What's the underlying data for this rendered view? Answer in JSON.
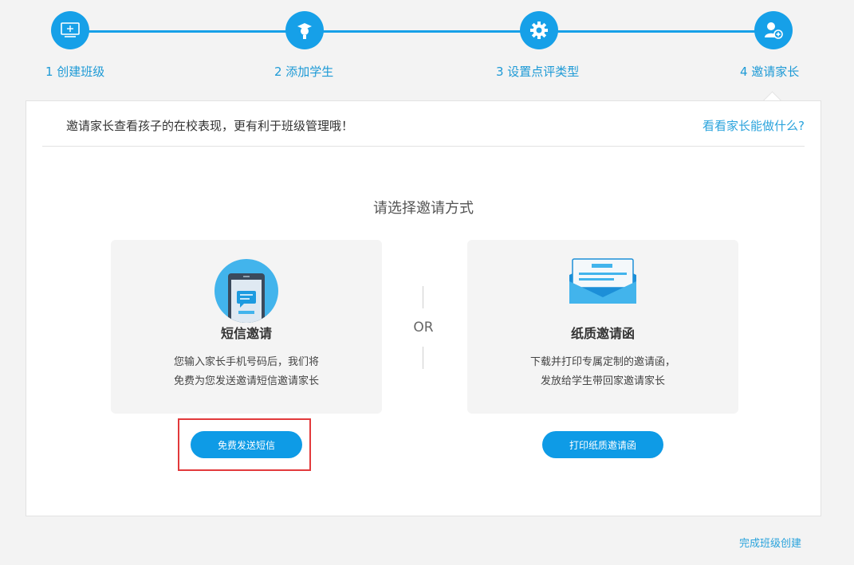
{
  "steps": [
    {
      "label": "1 创建班级",
      "icon": "monitor-plus-icon"
    },
    {
      "label": "2 添加学生",
      "icon": "student-icon"
    },
    {
      "label": "3 设置点评类型",
      "icon": "gear-icon"
    },
    {
      "label": "4 邀请家长",
      "icon": "add-parent-icon"
    }
  ],
  "header": {
    "intro": "邀请家长查看孩子的在校表现，更有利于班级管理哦！",
    "help_link": "看看家长能做什么?"
  },
  "choose_title": "请选择邀请方式",
  "or_text": "OR",
  "sms_card": {
    "title": "短信邀请",
    "desc_line1": "您输入家长手机号码后，我们将",
    "desc_line2": "免费为您发送邀请短信邀请家长",
    "button": "免费发送短信",
    "icon": "phone-message-icon"
  },
  "paper_card": {
    "title": "纸质邀请函",
    "desc_line1": "下载并打印专属定制的邀请函，",
    "desc_line2": "发放给学生带回家邀请家长",
    "button": "打印纸质邀请函",
    "icon": "envelope-letter-icon"
  },
  "finish_link": "完成班级创建",
  "colors": {
    "accent": "#16a0e8",
    "link": "#2aa3dc",
    "highlight": "#e2393b"
  }
}
